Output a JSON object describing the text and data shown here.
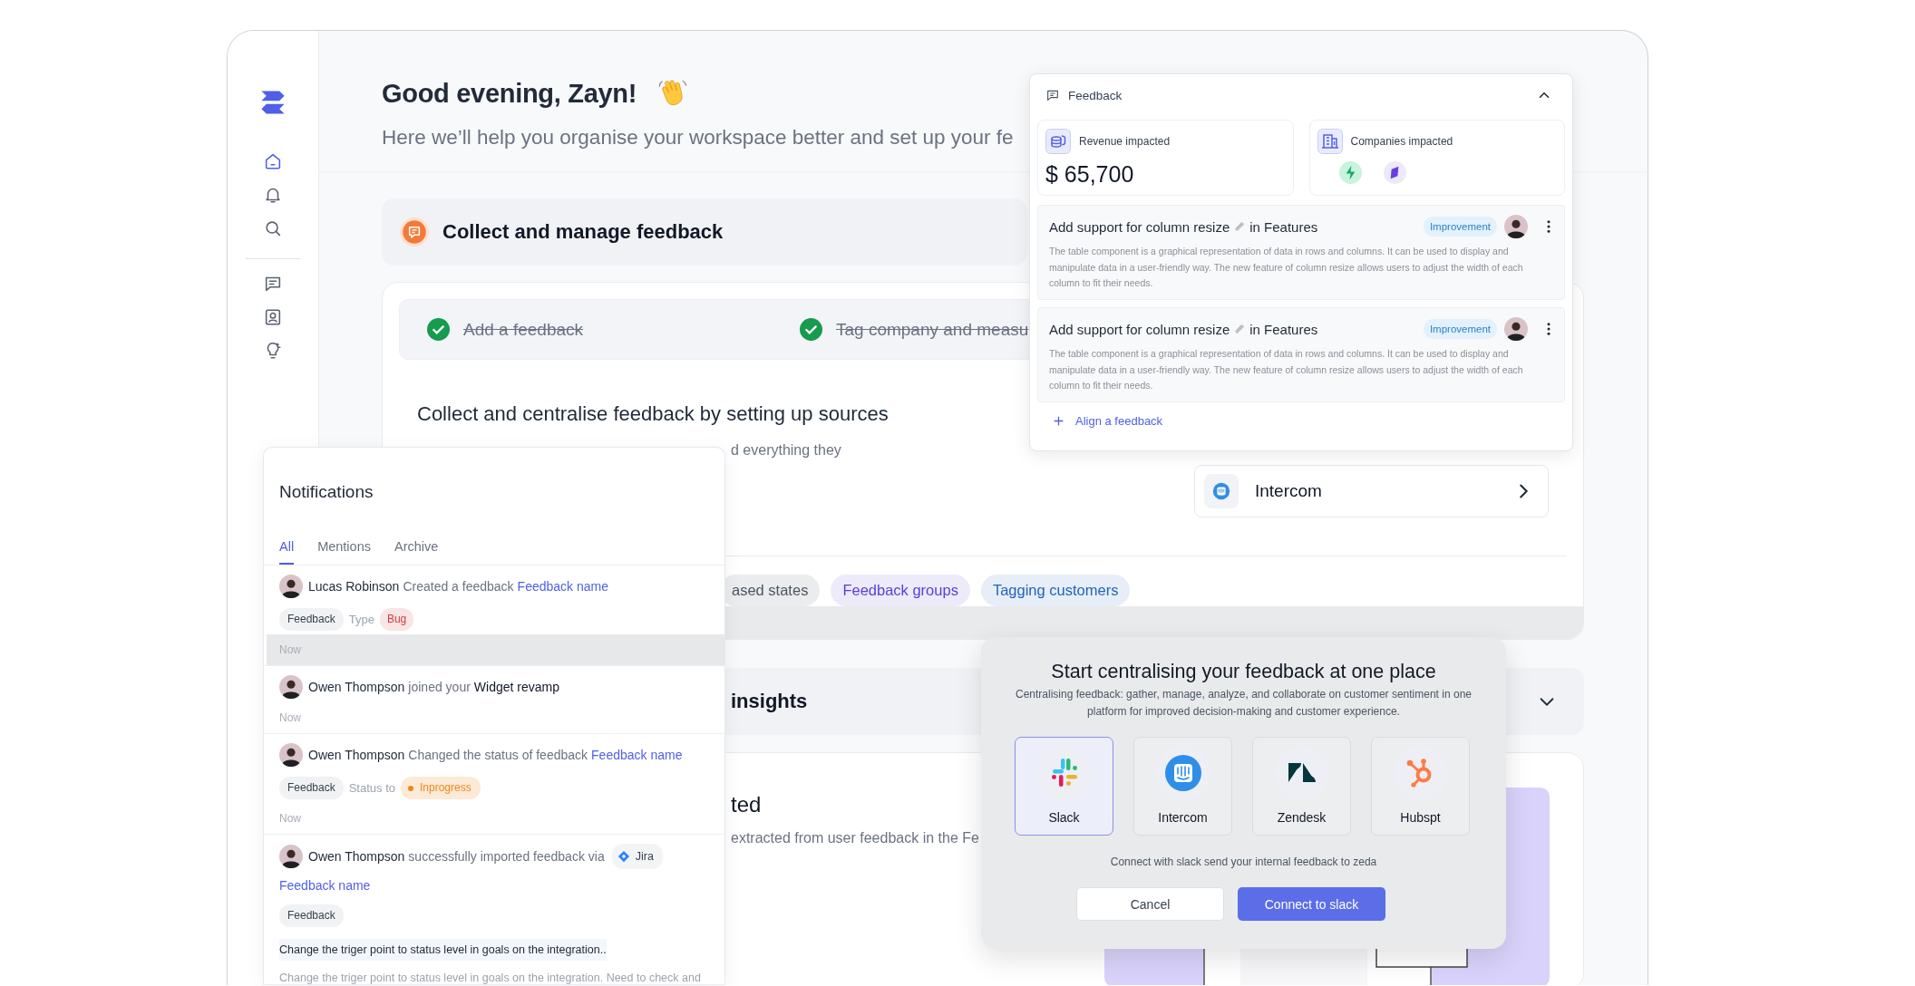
{
  "sidebar": {
    "primary": [
      {
        "kind": "home",
        "selected": true
      },
      {
        "kind": "bell",
        "selected": false
      },
      {
        "kind": "search",
        "selected": false
      }
    ],
    "secondary": [
      {
        "kind": "chat",
        "selected": false
      },
      {
        "kind": "contact",
        "selected": false
      },
      {
        "kind": "bulb",
        "selected": false
      }
    ]
  },
  "greeting": {
    "title": "Good evening, Zayn!",
    "subtitle": "Here we’ll help you organise your workspace better and set up your fe"
  },
  "collect_section": {
    "title": "Collect and manage feedback",
    "steps": [
      {
        "label": "Add a feedback",
        "done": true
      },
      {
        "label": "Tag company and measu",
        "done": true
      }
    ],
    "heading": "Collect and centralise feedback by setting up sources",
    "description": "d everything they",
    "source": {
      "name": "Intercom"
    },
    "chips": [
      {
        "label": "ased states",
        "color": "#4b5563"
      },
      {
        "label": "Feedback groups",
        "color": "#5b3fd6"
      },
      {
        "label": "Tagging customers",
        "color": "#2563b8"
      }
    ]
  },
  "insights_section": {
    "title": "insights",
    "expanded": false
  },
  "extracted_section": {
    "title": "ted",
    "description": "extracted from user feedback in the Fe"
  },
  "feedback_panel": {
    "title": "Feedback",
    "expanded": true,
    "revenue": {
      "label": "Revenue impacted",
      "value": "$ 65,700"
    },
    "companies": {
      "label": "Companies impacted"
    },
    "items": [
      {
        "title": "Add support for column resize",
        "suffix": "in Features",
        "tag": "Improvement",
        "description": "The table component is a graphical representation of data in rows and columns. It can be used to display and manipulate data in a user-friendly way. The new feature of column resize allows users to adjust the width of each column to fit their needs."
      },
      {
        "title": "Add support for column resize",
        "suffix": "in Features",
        "tag": "Improvement",
        "description": "The table component is a graphical representation of data in rows and columns. It can be used to display and manipulate data in a user-friendly way. The new feature of column resize allows users to adjust the width of each column to fit their needs."
      }
    ],
    "action": "Align a feedback"
  },
  "notifications": {
    "title": "Notifications",
    "tabs": [
      {
        "label": "All",
        "selected": true
      },
      {
        "label": "Mentions",
        "selected": false
      },
      {
        "label": "Archive",
        "selected": false
      }
    ],
    "items": [
      {
        "actor": "Lucas Robinson",
        "action": "Created a feedback",
        "target": {
          "text": "Feedback name",
          "kind": "link"
        },
        "tags": [
          {
            "kind": "tag",
            "text": "Feedback"
          },
          {
            "kind": "label",
            "text": "Type"
          },
          {
            "kind": "badge",
            "text": "Bug",
            "color": "#d23b3b"
          }
        ],
        "time": "Now",
        "highlighted": true
      },
      {
        "actor": "Owen Thompson",
        "action": "joined your",
        "target": {
          "text": "Widget revamp",
          "kind": "strong"
        },
        "time": "Now",
        "highlighted": false
      },
      {
        "actor": "Owen Thompson",
        "action": "Changed the status of feedback",
        "target": {
          "text": "Feedback name",
          "kind": "link"
        },
        "tags": [
          {
            "kind": "tag",
            "text": "Feedback"
          },
          {
            "kind": "label",
            "text": "Status to"
          },
          {
            "kind": "status",
            "text": "Inprogress",
            "color": "#f0881a"
          }
        ],
        "time": "Now",
        "highlighted": false
      },
      {
        "actor": "Owen Thompson",
        "action": "successfully imported feedback via",
        "source": "Jira",
        "target": {
          "text": "Feedback name",
          "kind": "link"
        },
        "tags": [
          {
            "kind": "tag",
            "text": "Feedback"
          }
        ],
        "comment_title": "Change the triger point to status level in goals on the integration..",
        "comment_body": "Change the triger point to status level in goals on the integration. Need to check and",
        "highlighted": false
      }
    ]
  },
  "modal": {
    "title": "Start centralising your feedback at one place",
    "description": "Centralising feedback: gather, manage, analyze, and collaborate on customer sentiment in one platform for improved decision-making and customer experience.",
    "integrations": [
      {
        "name": "Slack",
        "kind": "slack",
        "selected": true
      },
      {
        "name": "Intercom",
        "kind": "intercom",
        "selected": false
      },
      {
        "name": "Zendesk",
        "kind": "zendesk",
        "selected": false
      },
      {
        "name": "Hubspt",
        "kind": "hubspot",
        "selected": false
      }
    ],
    "hint": "Connect with slack send your internal feedback to zeda",
    "buttons": [
      {
        "label": "Cancel",
        "kind": "secondary"
      },
      {
        "label": "Connect to slack",
        "kind": "primary"
      }
    ]
  }
}
